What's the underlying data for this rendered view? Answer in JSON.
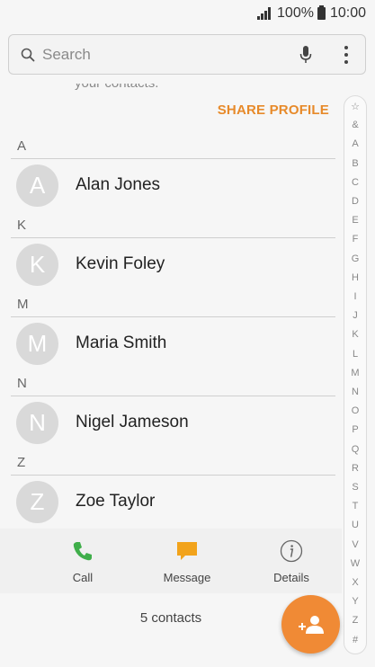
{
  "status_bar": {
    "battery": "100%",
    "time": "10:00"
  },
  "search": {
    "placeholder": "Search"
  },
  "header": {
    "partial_text": "your contacts.",
    "share_profile_label": "SHARE PROFILE"
  },
  "sections": [
    {
      "letter": "A",
      "contacts": [
        {
          "initial": "A",
          "name": "Alan Jones"
        }
      ]
    },
    {
      "letter": "K",
      "contacts": [
        {
          "initial": "K",
          "name": "Kevin Foley"
        }
      ]
    },
    {
      "letter": "M",
      "contacts": [
        {
          "initial": "M",
          "name": "Maria Smith"
        }
      ]
    },
    {
      "letter": "N",
      "contacts": [
        {
          "initial": "N",
          "name": "Nigel Jameson"
        }
      ]
    },
    {
      "letter": "Z",
      "contacts": [
        {
          "initial": "Z",
          "name": "Zoe Taylor"
        }
      ]
    }
  ],
  "index_letters": [
    "☆",
    "&",
    "A",
    "B",
    "C",
    "D",
    "E",
    "F",
    "G",
    "H",
    "I",
    "J",
    "K",
    "L",
    "M",
    "N",
    "O",
    "P",
    "Q",
    "R",
    "S",
    "T",
    "U",
    "V",
    "W",
    "X",
    "Y",
    "Z",
    "#"
  ],
  "actions": {
    "call_label": "Call",
    "message_label": "Message",
    "details_label": "Details"
  },
  "footer": {
    "count_label": "5 contacts"
  },
  "colors": {
    "accent": "#e78a2a",
    "fab": "#f08a35",
    "call": "#3fae4a",
    "message": "#f2a31b"
  }
}
